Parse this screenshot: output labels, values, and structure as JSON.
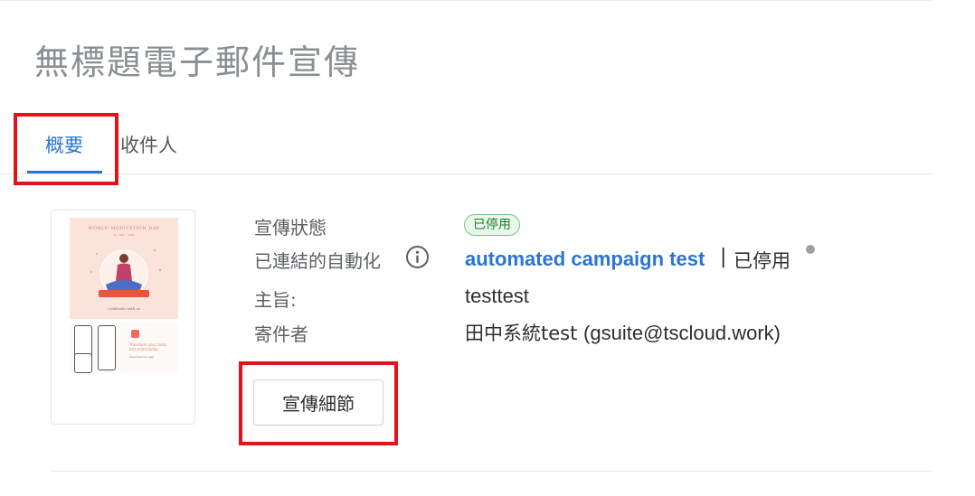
{
  "page": {
    "title": "無標題電子郵件宣傳"
  },
  "tabs": [
    {
      "label": "概要",
      "active": true
    },
    {
      "label": "收件人",
      "active": false
    }
  ],
  "colors": {
    "accent": "#2a74d6",
    "highlight": "#e0151c",
    "status_green": "#1e7d30",
    "status_dot": "#9aa1a7"
  },
  "thumbnail": {
    "heading": "WORLD MEDITATION DAY",
    "date": "21 · MAY · 2021",
    "subtitle": "Celebrate with us",
    "promo_text": "Transform your body and mind today",
    "promo_sub": "download our app"
  },
  "details": {
    "status_label": "宣傳狀態",
    "status_badge": "已停用",
    "automation_label": "已連結的自動化",
    "automation_info_icon": "info-icon",
    "automation_name": "automated campaign test",
    "automation_separator": "|",
    "automation_status": "已停用",
    "subject_label": "主旨:",
    "subject_value": "testtest",
    "sender_label": "寄件者",
    "sender_name": "田中系統test",
    "sender_email": "(gsuite@tscloud.work)"
  },
  "actions": {
    "details_button": "宣傳細節"
  }
}
